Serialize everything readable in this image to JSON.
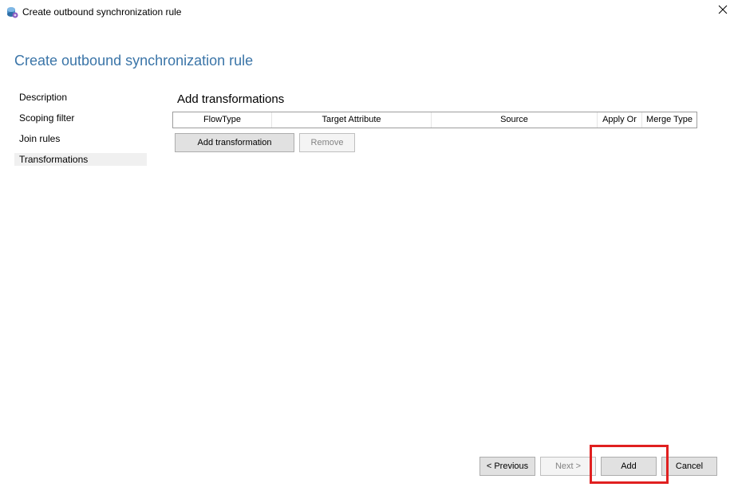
{
  "window": {
    "title": "Create outbound synchronization rule",
    "app_icon": "sync-service-icon",
    "close_icon": "close-icon"
  },
  "page": {
    "title": "Create outbound synchronization rule"
  },
  "nav": {
    "items": [
      {
        "label": "Description",
        "selected": false
      },
      {
        "label": "Scoping filter",
        "selected": false
      },
      {
        "label": "Join rules",
        "selected": false
      },
      {
        "label": "Transformations",
        "selected": true
      }
    ]
  },
  "main": {
    "section_title": "Add transformations",
    "grid": {
      "columns": [
        "FlowType",
        "Target Attribute",
        "Source",
        "Apply Or",
        "Merge Type"
      ],
      "rows": []
    },
    "add_transformation_label": "Add transformation",
    "remove_label": "Remove"
  },
  "footer": {
    "previous_label": "< Previous",
    "next_label": "Next >",
    "add_label": "Add",
    "cancel_label": "Cancel"
  },
  "colors": {
    "title_accent": "#3b75a8",
    "highlight": "#e02020"
  }
}
